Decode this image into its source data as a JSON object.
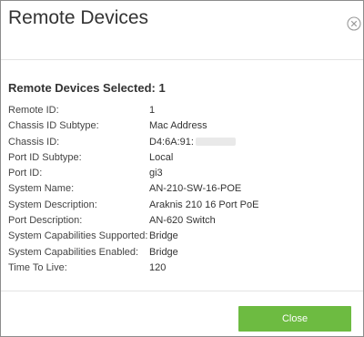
{
  "dialog": {
    "title": "Remote Devices",
    "close_icon": "circle-x-icon"
  },
  "section": {
    "heading": "Remote Devices Selected: 1"
  },
  "properties": [
    {
      "label": "Remote ID:",
      "value": "1"
    },
    {
      "label": "Chassis ID Subtype:",
      "value": "Mac Address"
    },
    {
      "label": "Chassis ID:",
      "value": "D4:6A:91:"
    },
    {
      "label": "Port ID Subtype:",
      "value": "Local"
    },
    {
      "label": "Port ID:",
      "value": "gi3"
    },
    {
      "label": "System Name:",
      "value": "AN-210-SW-16-POE"
    },
    {
      "label": "System Description:",
      "value": "Araknis 210 16 Port PoE"
    },
    {
      "label": "Port Description:",
      "value": "AN-620 Switch"
    },
    {
      "label": "System Capabilities Supported:",
      "value": "Bridge"
    },
    {
      "label": "System Capabilities Enabled:",
      "value": "Bridge"
    },
    {
      "label": "Time To Live:",
      "value": "120"
    }
  ],
  "footer": {
    "close_label": "Close"
  },
  "colors": {
    "accent": "#6dbb41",
    "text": "#333333",
    "border": "#8c8c8c"
  }
}
